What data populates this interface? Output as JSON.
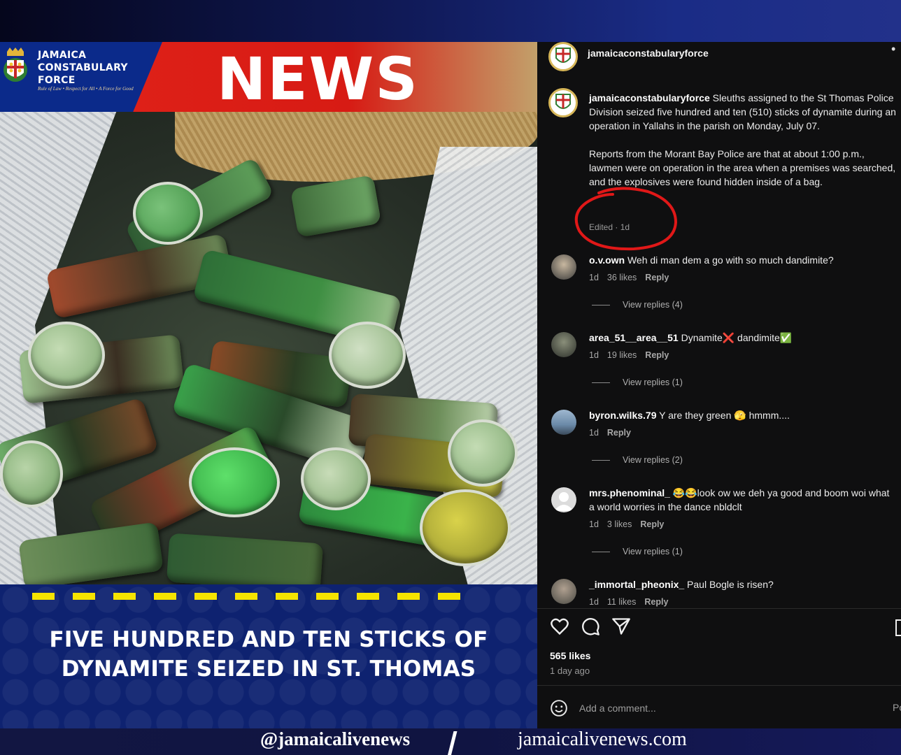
{
  "graphic": {
    "org_name": "JAMAICA CONSTABULARY FORCE",
    "motto": "Rule of Law • Respect for All • A Force for Good",
    "banner_word": "NEWS",
    "headline": "FIVE HUNDRED AND TEN STICKS OF DYNAMITE SEIZED IN ST. THOMAS",
    "colors": {
      "red": "#e2231a",
      "navy": "#0e2270",
      "hazard_yellow": "#f5e400"
    }
  },
  "post": {
    "username": "jamaicaconstabularyforce",
    "caption_user": "jamaicaconstabularyforce",
    "caption_p1": "Sleuths assigned to the St Thomas Police Division seized five hundred and ten (510) sticks of dynamite during an operation in Yallahs in the parish on Monday, July 07.",
    "caption_p2": "Reports from the Morant Bay Police are that at about 1:00 p.m., lawmen were on operation in the area when a premises was searched, and the explosives were found hidden inside of a bag.",
    "edited": "Edited · 1d",
    "likes": "565 likes",
    "posted_ago": "1 day ago",
    "add_comment_placeholder": "Add a comment...",
    "post_label": "Post"
  },
  "comments": [
    {
      "user": "o.v.own",
      "text": "Weh di man dem a go with so much dandimite?",
      "age": "1d",
      "likes": "36 likes",
      "reply": "Reply",
      "view_replies": "View replies (4)"
    },
    {
      "user": "area_51__area__51",
      "text": "Dynamite❌ dandimite✅",
      "age": "1d",
      "likes": "19 likes",
      "reply": "Reply",
      "view_replies": "View replies (1)"
    },
    {
      "user": "byron.wilks.79",
      "text": "Y are they green 🫣 hmmm....",
      "age": "1d",
      "likes": "",
      "reply": "Reply",
      "view_replies": "View replies (2)"
    },
    {
      "user": "mrs.phenominal_",
      "text": "😂😂look ow we deh ya good and boom woi what a world worries in the dance nbldclt",
      "age": "1d",
      "likes": "3 likes",
      "reply": "Reply",
      "view_replies": "View replies (1)"
    },
    {
      "user": "_immortal_pheonix_",
      "text": "Paul Bogle is risen?",
      "age": "1d",
      "likes": "11 likes",
      "reply": "Reply",
      "view_replies": ""
    }
  ],
  "icons": [
    "heart-icon",
    "comment-icon",
    "share-icon",
    "bookmark-icon",
    "emoji-icon",
    "more-options-icon"
  ],
  "footer": {
    "handle": "@jamaicalivenews",
    "site": "jamaicalivenews.com"
  }
}
